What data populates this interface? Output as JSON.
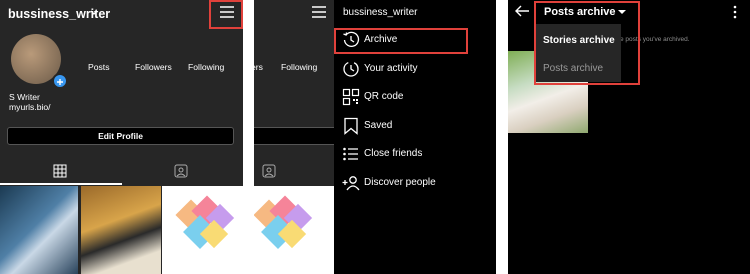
{
  "panel1": {
    "username": "bussiness_writer",
    "stats": [
      "Posts",
      "Followers",
      "Following"
    ],
    "name": "S Writer",
    "bio_link": "myurls.bio/",
    "edit_profile_label": "Edit Profile"
  },
  "panel2": {
    "stats_partial": [
      "ers",
      "Following"
    ],
    "menu_username": "bussiness_writer",
    "menu_items": [
      {
        "label": "Archive",
        "icon": "archive-clock-icon"
      },
      {
        "label": "Your activity",
        "icon": "activity-icon"
      },
      {
        "label": "QR code",
        "icon": "qr-code-icon"
      },
      {
        "label": "Saved",
        "icon": "bookmark-icon"
      },
      {
        "label": "Close friends",
        "icon": "close-friends-list-icon"
      },
      {
        "label": "Discover people",
        "icon": "add-person-icon"
      }
    ]
  },
  "panel3": {
    "title": "Posts archive",
    "dropdown_options": [
      "Stories archive",
      "Posts archive"
    ],
    "hint_text": "e posts you've archived."
  },
  "colors": {
    "highlight": "#e0413b",
    "dark_bg": "#262626",
    "black_bg": "#000000",
    "accent_blue": "#3897f0"
  }
}
